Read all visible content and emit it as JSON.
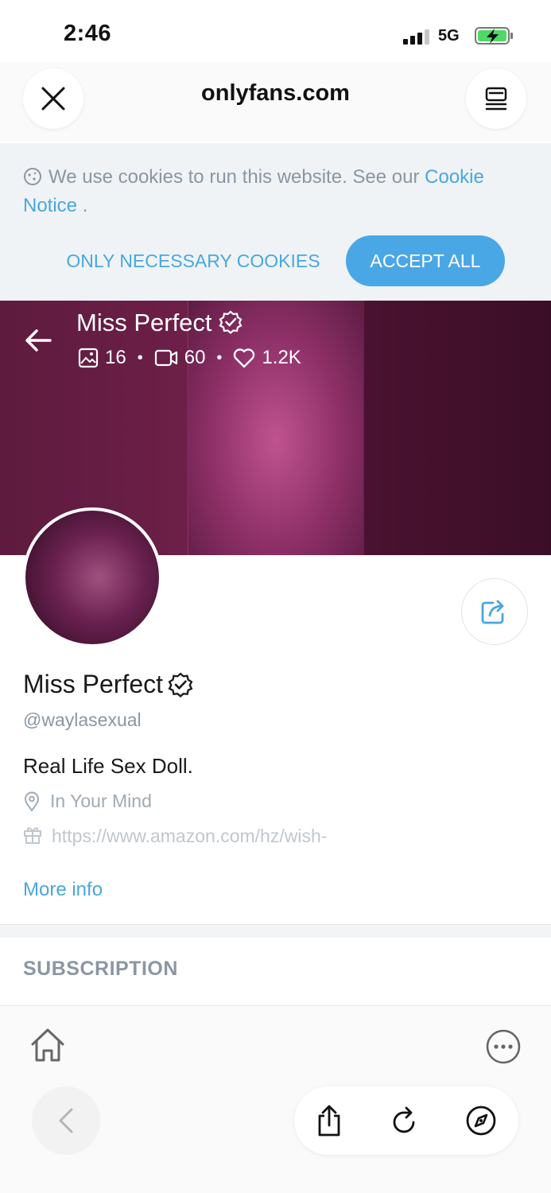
{
  "status_bar": {
    "time": "2:46",
    "network": "5G"
  },
  "browser": {
    "url": "onlyfans.com"
  },
  "cookie_banner": {
    "text": "We use cookies to run this website. See our ",
    "link1": "Cookie",
    "link2": "Notice",
    "suffix": " .",
    "necessary_label": "ONLY NECESSARY COOKIES",
    "accept_label": "ACCEPT ALL"
  },
  "cover": {
    "title": "Miss Perfect",
    "photos": "16",
    "videos": "60",
    "likes": "1.2K"
  },
  "profile": {
    "name": "Miss Perfect",
    "handle": "@waylasexual",
    "bio": "Real Life Sex Doll.",
    "location": "In Your Mind",
    "wishlist": "https://www.amazon.com/hz/wish-",
    "more_info": "More info"
  },
  "section": {
    "subscription": "SUBSCRIPTION"
  },
  "colors": {
    "accent": "#4aa7dd",
    "muted": "#8a96a3"
  }
}
